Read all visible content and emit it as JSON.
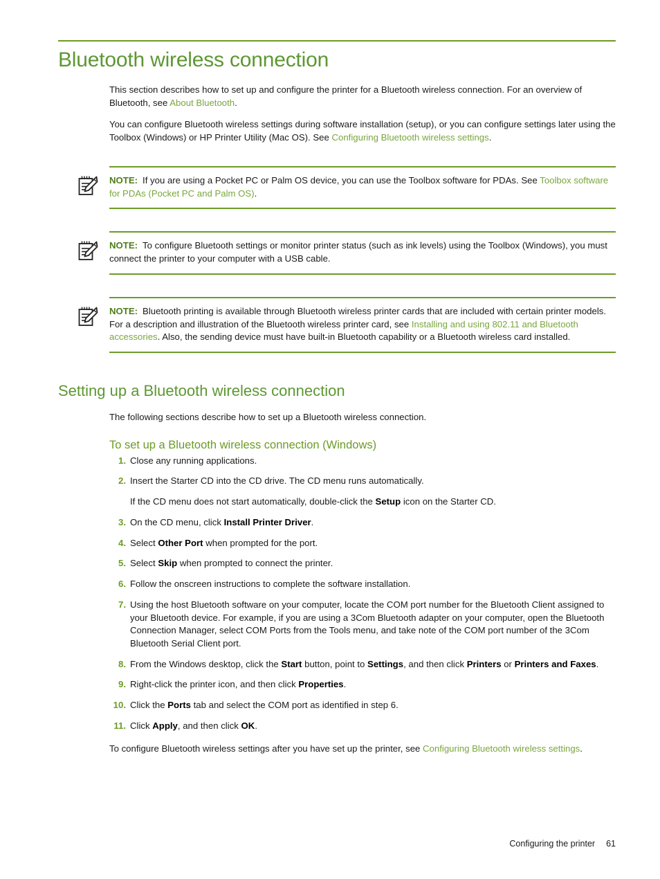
{
  "page": {
    "accent_green": "#5d9732",
    "link_green": "#7aa63c",
    "rule_green": "#6d9b26",
    "note_label_green": "#4e7d19"
  },
  "chapter": {
    "title": "Bluetooth wireless connection",
    "intro_paragraph_1": {
      "part1": "This section describes how to set up and configure the printer for a Bluetooth wireless connection. For an overview of Bluetooth, see ",
      "link": "About Bluetooth",
      "part2": "."
    },
    "intro_paragraph_2": {
      "part1": "You can configure Bluetooth wireless settings during software installation (setup), or you can configure settings later using the Toolbox (Windows) or HP Printer Utility (Mac OS). See ",
      "link": "Configuring Bluetooth wireless settings",
      "part2": "."
    }
  },
  "notes": [
    {
      "icon": "note-pad-pencil-icon",
      "label": "NOTE:",
      "text_part1": "If you are using a Pocket PC or Palm OS device, you can use the Toolbox software for PDAs. See ",
      "link": "Toolbox software for PDAs (Pocket PC and Palm OS)",
      "text_part2": "."
    },
    {
      "icon": "note-pad-pencil-icon",
      "label": "NOTE:",
      "text_part1": "To configure Bluetooth settings or monitor printer status (such as ink levels) using the Toolbox (Windows), you must connect the printer to your computer with a USB cable.",
      "link": "",
      "text_part2": ""
    },
    {
      "icon": "note-pad-pencil-icon",
      "label": "NOTE:",
      "text_part1": "Bluetooth printing is available through Bluetooth wireless printer cards that are included with certain printer models. For a description and illustration of the Bluetooth wireless printer card, see ",
      "link": "Installing and using 802.11 and Bluetooth accessories",
      "text_part2": ". Also, the sending device must have built-in Bluetooth capability or a Bluetooth wireless card installed."
    }
  ],
  "section": {
    "title": "Setting up a Bluetooth wireless connection",
    "intro": "The following sections describe how to set up a Bluetooth wireless connection.",
    "subsection_title": "To set up a Bluetooth wireless connection (Windows)"
  },
  "steps": [
    {
      "num": "1.",
      "segments": [
        {
          "type": "text",
          "value": "Close any running applications."
        }
      ]
    },
    {
      "num": "2.",
      "segments": [
        {
          "type": "text",
          "value": "Insert the Starter CD into the CD drive. The CD menu runs automatically."
        }
      ],
      "sub_segments": [
        {
          "type": "text",
          "value": "If the CD menu does not start automatically, double-click the "
        },
        {
          "type": "bold",
          "value": "Setup"
        },
        {
          "type": "text",
          "value": " icon on the Starter CD."
        }
      ]
    },
    {
      "num": "3.",
      "segments": [
        {
          "type": "text",
          "value": "On the CD menu, click "
        },
        {
          "type": "bold",
          "value": "Install Printer Driver"
        },
        {
          "type": "text",
          "value": "."
        }
      ]
    },
    {
      "num": "4.",
      "segments": [
        {
          "type": "text",
          "value": "Select "
        },
        {
          "type": "bold",
          "value": "Other Port"
        },
        {
          "type": "text",
          "value": " when prompted for the port."
        }
      ]
    },
    {
      "num": "5.",
      "segments": [
        {
          "type": "text",
          "value": "Select "
        },
        {
          "type": "bold",
          "value": "Skip"
        },
        {
          "type": "text",
          "value": " when prompted to connect the printer."
        }
      ]
    },
    {
      "num": "6.",
      "segments": [
        {
          "type": "text",
          "value": "Follow the onscreen instructions to complete the software installation."
        }
      ]
    },
    {
      "num": "7.",
      "segments": [
        {
          "type": "text",
          "value": "Using the host Bluetooth software on your computer, locate the COM port number for the Bluetooth Client assigned to your Bluetooth device. For example, if you are using a 3Com Bluetooth adapter on your computer, open the Bluetooth Connection Manager, select COM Ports from the Tools menu, and take note of the COM port number of the 3Com Bluetooth Serial Client port."
        }
      ]
    },
    {
      "num": "8.",
      "segments": [
        {
          "type": "text",
          "value": "From the Windows desktop, click the "
        },
        {
          "type": "bold",
          "value": "Start"
        },
        {
          "type": "text",
          "value": " button, point to "
        },
        {
          "type": "bold",
          "value": "Settings"
        },
        {
          "type": "text",
          "value": ", and then click "
        },
        {
          "type": "bold",
          "value": "Printers"
        },
        {
          "type": "text",
          "value": " or "
        },
        {
          "type": "bold",
          "value": "Printers and Faxes"
        },
        {
          "type": "text",
          "value": "."
        }
      ]
    },
    {
      "num": "9.",
      "segments": [
        {
          "type": "text",
          "value": "Right-click the printer icon, and then click "
        },
        {
          "type": "bold",
          "value": "Properties"
        },
        {
          "type": "text",
          "value": "."
        }
      ]
    },
    {
      "num": "10.",
      "segments": [
        {
          "type": "text",
          "value": "Click the "
        },
        {
          "type": "bold",
          "value": "Ports"
        },
        {
          "type": "text",
          "value": " tab and select the COM port as identified in step 6."
        }
      ]
    },
    {
      "num": "11.",
      "segments": [
        {
          "type": "text",
          "value": "Click "
        },
        {
          "type": "bold",
          "value": "Apply"
        },
        {
          "type": "text",
          "value": ", and then click "
        },
        {
          "type": "bold",
          "value": "OK"
        },
        {
          "type": "text",
          "value": "."
        }
      ]
    }
  ],
  "closing": {
    "part1": "To configure Bluetooth wireless settings after you have set up the printer, see ",
    "link": "Configuring Bluetooth wireless settings",
    "part2": "."
  },
  "footer": {
    "section_name": "Configuring the printer",
    "page_number": "61"
  }
}
